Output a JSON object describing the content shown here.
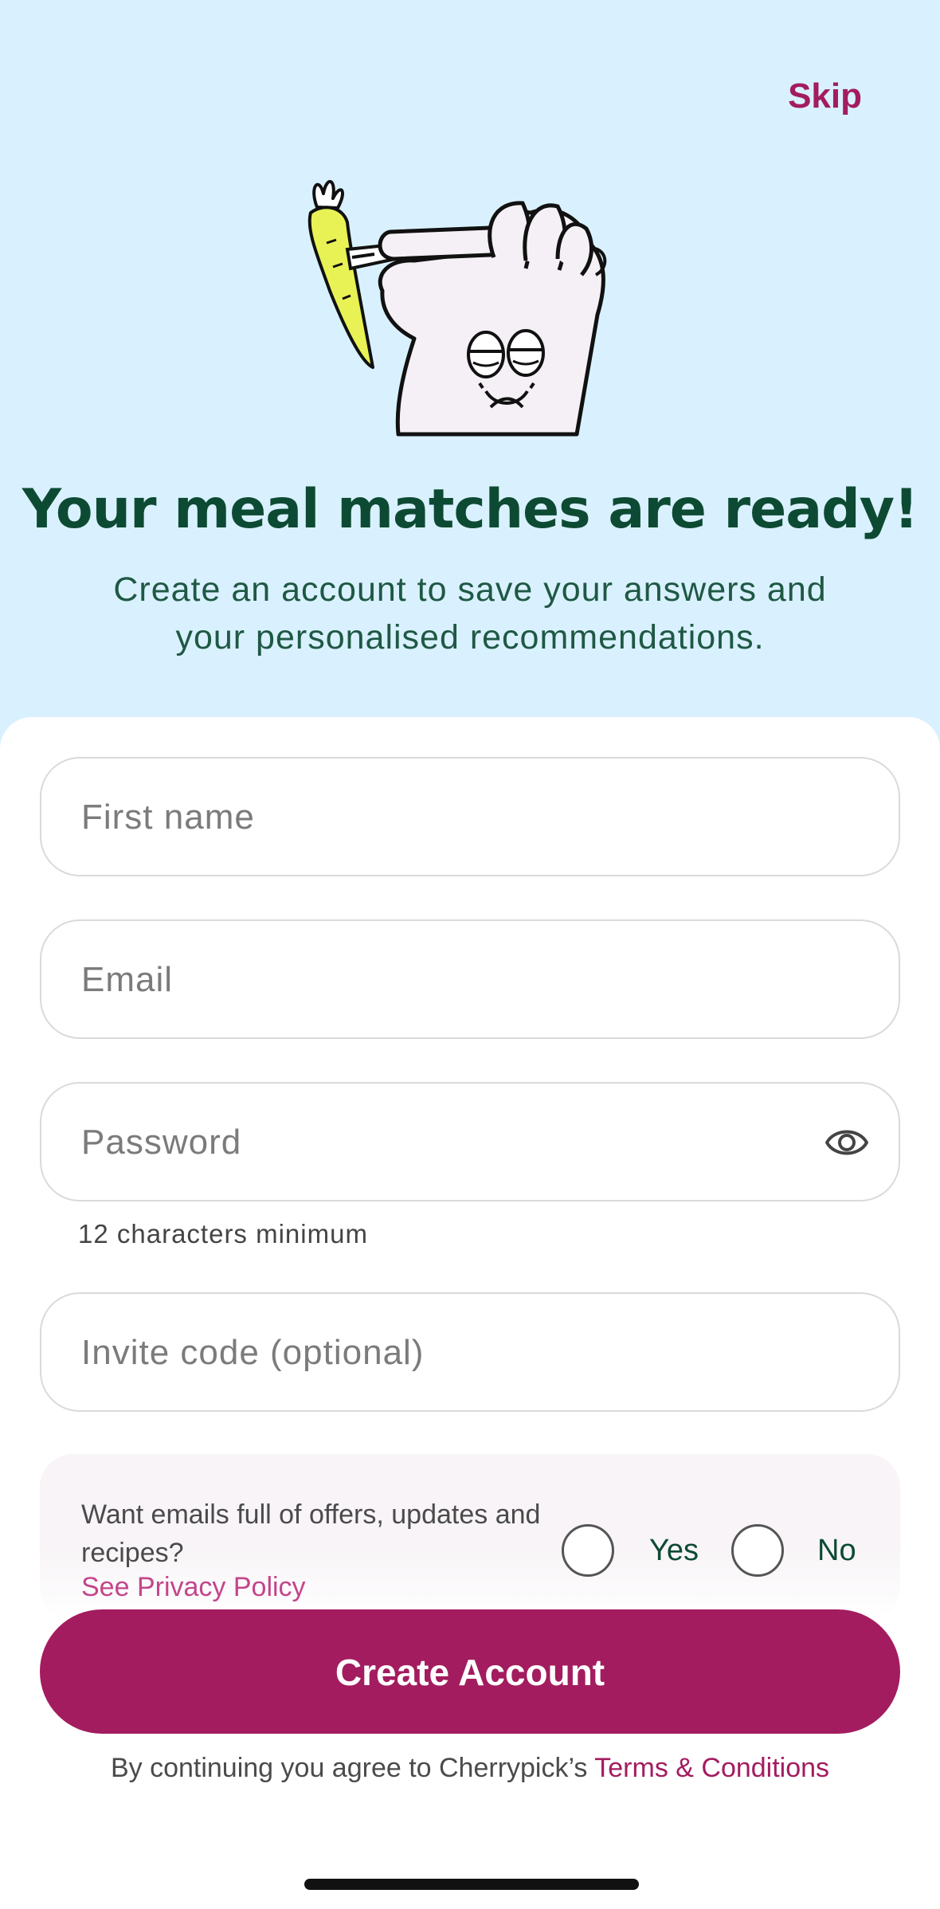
{
  "header": {
    "skip_label": "Skip",
    "illustration_icon": "hand-holding-fork-with-carrot-icon"
  },
  "headline": "Your meal matches are ready!",
  "subtitle": "Create an account to save your answers and your personalised recommendations.",
  "form": {
    "first_name": {
      "placeholder": "First name",
      "value": ""
    },
    "email": {
      "placeholder": "Email",
      "value": ""
    },
    "password": {
      "placeholder": "Password",
      "value": "",
      "hint": "12 characters minimum",
      "toggle_icon": "eye-icon"
    },
    "invite_code": {
      "placeholder": "Invite code (optional)",
      "value": ""
    }
  },
  "marketing_optin": {
    "question": "Want emails full of offers, updates and recipes?",
    "privacy_link": "See Privacy Policy",
    "yes_label": "Yes",
    "no_label": "No",
    "selected": null
  },
  "cta": {
    "label": "Create Account"
  },
  "legal": {
    "prefix": "By continuing you agree to Cherrypick’s ",
    "link": "Terms & Conditions"
  },
  "colors": {
    "hero_bg": "#d9f1fe",
    "brand": "#a31c5f",
    "headline": "#0d4a33",
    "carrot": "#e8f255"
  }
}
